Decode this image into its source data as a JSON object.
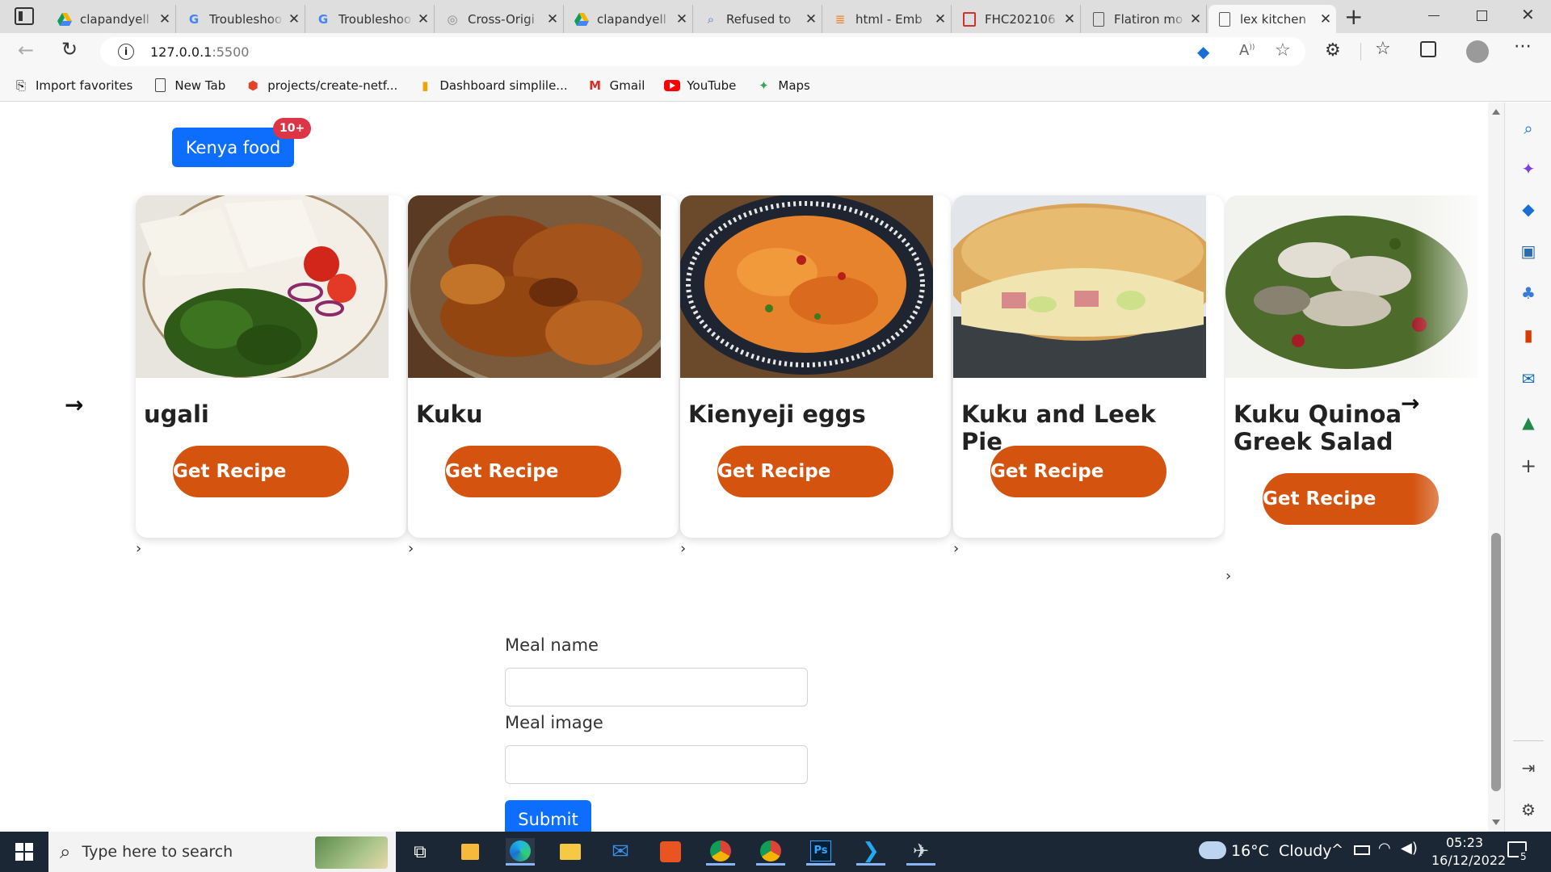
{
  "browser": {
    "tabs": [
      {
        "label": "clapandyell",
        "icon": "drive-icon"
      },
      {
        "label": "Troubleshoo",
        "icon": "google-icon"
      },
      {
        "label": "Troubleshoo",
        "icon": "google-icon"
      },
      {
        "label": "Cross-Origi",
        "icon": "globe-icon"
      },
      {
        "label": "clapandyell",
        "icon": "drive-icon"
      },
      {
        "label": "Refused to",
        "icon": "search-icon"
      },
      {
        "label": "html - Emb",
        "icon": "stackoverflow-icon"
      },
      {
        "label": "FHC202106",
        "icon": "pdf-icon"
      },
      {
        "label": "Flatiron mo",
        "icon": "page-icon"
      },
      {
        "label": "lex kitchen",
        "icon": "page-icon",
        "active": true
      }
    ],
    "url": "127.0.0.1:5500",
    "url_host": "127.0.0.1",
    "url_port": ":5500",
    "bookmarks": [
      {
        "label": "Import favorites",
        "icon": "import-icon"
      },
      {
        "label": "New Tab",
        "icon": "page-icon"
      },
      {
        "label": "projects/create-netf...",
        "icon": "gitlab-icon"
      },
      {
        "label": "Dashboard simplile...",
        "icon": "dashboard-icon"
      },
      {
        "label": "Gmail",
        "icon": "gmail-icon"
      },
      {
        "label": "YouTube",
        "icon": "youtube-icon"
      },
      {
        "label": "Maps",
        "icon": "maps-icon"
      }
    ]
  },
  "page": {
    "category_button": "Kenya food",
    "category_badge": "10+",
    "cards": [
      {
        "name": "ugali",
        "button": "Get Recipe"
      },
      {
        "name": "Kuku",
        "button": "Get Recipe"
      },
      {
        "name": "Kienyeji eggs",
        "button": "Get Recipe"
      },
      {
        "name": "Kuku and Leek Pie",
        "button": "Get Recipe"
      },
      {
        "name": "Kuku Quinoa Greek Salad",
        "button": "Get Recipe"
      }
    ],
    "form": {
      "meal_name_label": "Meal name",
      "meal_name_value": "",
      "meal_image_label": "Meal image",
      "meal_image_value": "",
      "submit_label": "Submit"
    }
  },
  "taskbar": {
    "search_placeholder": "Type here to search",
    "weather": "16°C  Cloudy",
    "time": "05:23",
    "date": "16/12/2022",
    "notification_count": "5"
  },
  "colors": {
    "accent_orange": "#d4530f",
    "primary_blue": "#0d6efd",
    "badge_red": "#dc3545"
  }
}
